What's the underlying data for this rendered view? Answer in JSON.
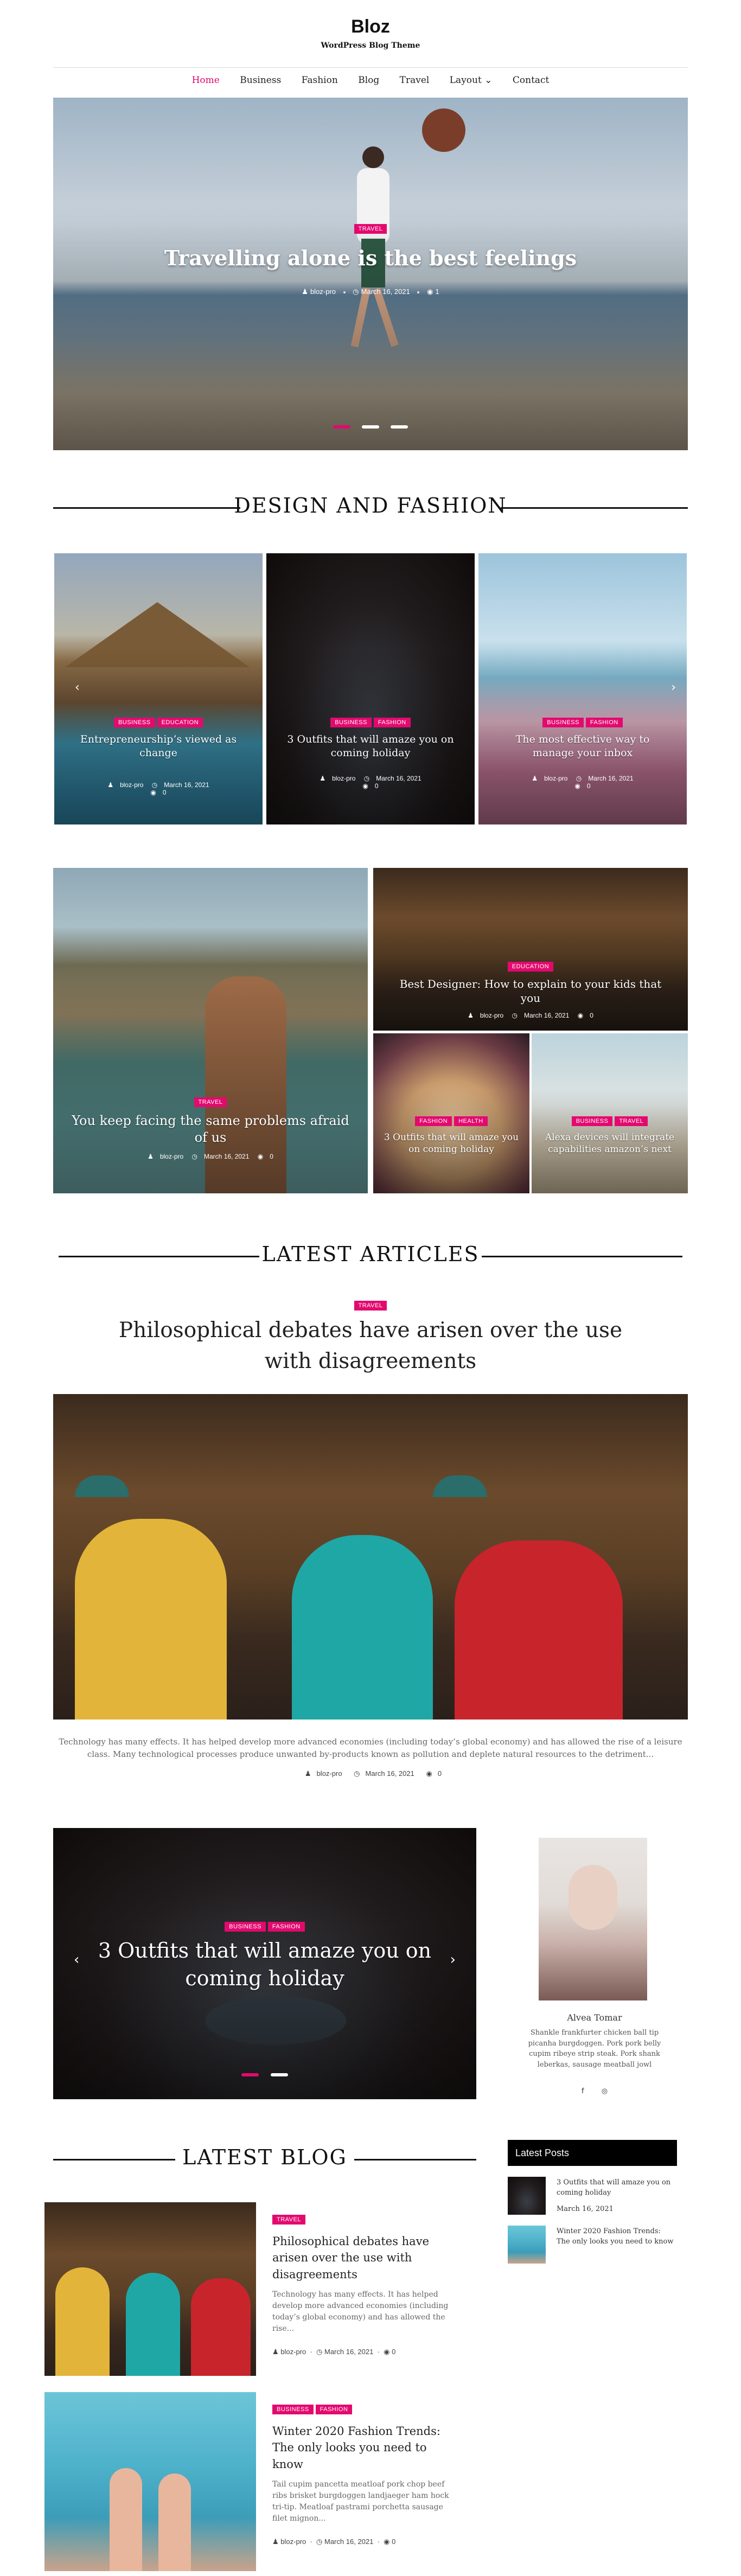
{
  "site": {
    "title": "Bloz",
    "tagline": "WordPress Blog Theme"
  },
  "nav": {
    "items": [
      {
        "label": "Home",
        "active": true
      },
      {
        "label": "Business"
      },
      {
        "label": "Fashion"
      },
      {
        "label": "Blog"
      },
      {
        "label": "Travel"
      },
      {
        "label": "Layout ⌄"
      },
      {
        "label": "Contact"
      }
    ]
  },
  "hero": {
    "tag": "Travel",
    "title": "Travelling alone is the best feelings",
    "author": "bloz-pro",
    "date": "March 16, 2021",
    "comments": "1"
  },
  "design_fashion": {
    "title": "DESIGN AND FASHION",
    "cards": [
      {
        "tags": [
          "Business",
          "Education"
        ],
        "title": "Entrepreneurship’s viewed as change",
        "author": "bloz-pro",
        "date": "March 16, 2021",
        "comments": "0"
      },
      {
        "tags": [
          "Business",
          "Fashion"
        ],
        "title": "3 Outfits that will amaze you on coming holiday",
        "author": "bloz-pro",
        "date": "March 16, 2021",
        "comments": "0"
      },
      {
        "tags": [
          "Business",
          "Fashion"
        ],
        "title": "The most effective way to manage your inbox",
        "author": "bloz-pro",
        "date": "March 16, 2021",
        "comments": "0"
      }
    ]
  },
  "grid": {
    "big": {
      "tag": "Travel",
      "title": "You keep facing the same problems afraid of us",
      "author": "bloz-pro",
      "date": "March 16, 2021",
      "comments": "0"
    },
    "top_right": {
      "tag": "Education",
      "title": "Best Designer: How to explain to your kids that you",
      "author": "bloz-pro",
      "date": "March 16, 2021",
      "comments": "0"
    },
    "bottom_left": {
      "tags": [
        "Fashion",
        "Health"
      ],
      "title": "3 Outfits that will amaze you on coming holiday"
    },
    "bottom_right": {
      "tags": [
        "Business",
        "Travel"
      ],
      "title": "Alexa devices will integrate capabilities amazon’s next"
    }
  },
  "latest_articles": {
    "title": "LATEST ARTICLES",
    "tag": "Travel",
    "headline": "Philosophical debates have arisen over the use with disagreements",
    "excerpt": "Technology has many effects. It has helped develop more advanced economies (including today’s global economy) and has allowed the rise of a leisure class. Many technological processes produce unwanted by-products known as pollution and deplete natural resources to the detriment...",
    "author": "bloz-pro",
    "date": "March 16, 2021",
    "comments": "0"
  },
  "slider2": {
    "tags": [
      "Business",
      "Fashion"
    ],
    "title": "3 Outfits that will amaze you on coming holiday"
  },
  "author_widget": {
    "name": "Alvea Tomar",
    "bio": "Shankle frankfurter chicken ball tip picanha burgdoggen. Pork pork belly cupim ribeye strip steak. Pork shank leberkas, sausage meatball jowl",
    "social": [
      "f",
      "◎"
    ]
  },
  "latest_blog": {
    "title": "LATEST BLOG",
    "posts": [
      {
        "tags": [
          "Travel"
        ],
        "title": "Philosophical debates have arisen over the use with disagreements",
        "excerpt": "Technology has many effects. It has helped develop more advanced economies (including today’s global economy) and has allowed the rise...",
        "author": "bloz-pro",
        "date": "March 16, 2021",
        "comments": "0"
      },
      {
        "tags": [
          "Business",
          "Fashion"
        ],
        "title": "Winter 2020 Fashion Trends: The only looks you need to know",
        "excerpt": "Tail cupim pancetta meatloaf pork chop beef ribs brisket burgdoggen landjaeger ham hock tri-tip. Meatloaf pastrami porchetta sausage filet mignon...",
        "author": "bloz-pro",
        "date": "March 16, 2021",
        "comments": "0"
      }
    ]
  },
  "latest_posts_widget": {
    "title": "Latest Posts",
    "items": [
      {
        "title": "3 Outfits that will amaze you on coming holiday",
        "date": "March 16, 2021"
      },
      {
        "title": "Winter 2020 Fashion Trends: The only looks you need to know"
      }
    ]
  }
}
